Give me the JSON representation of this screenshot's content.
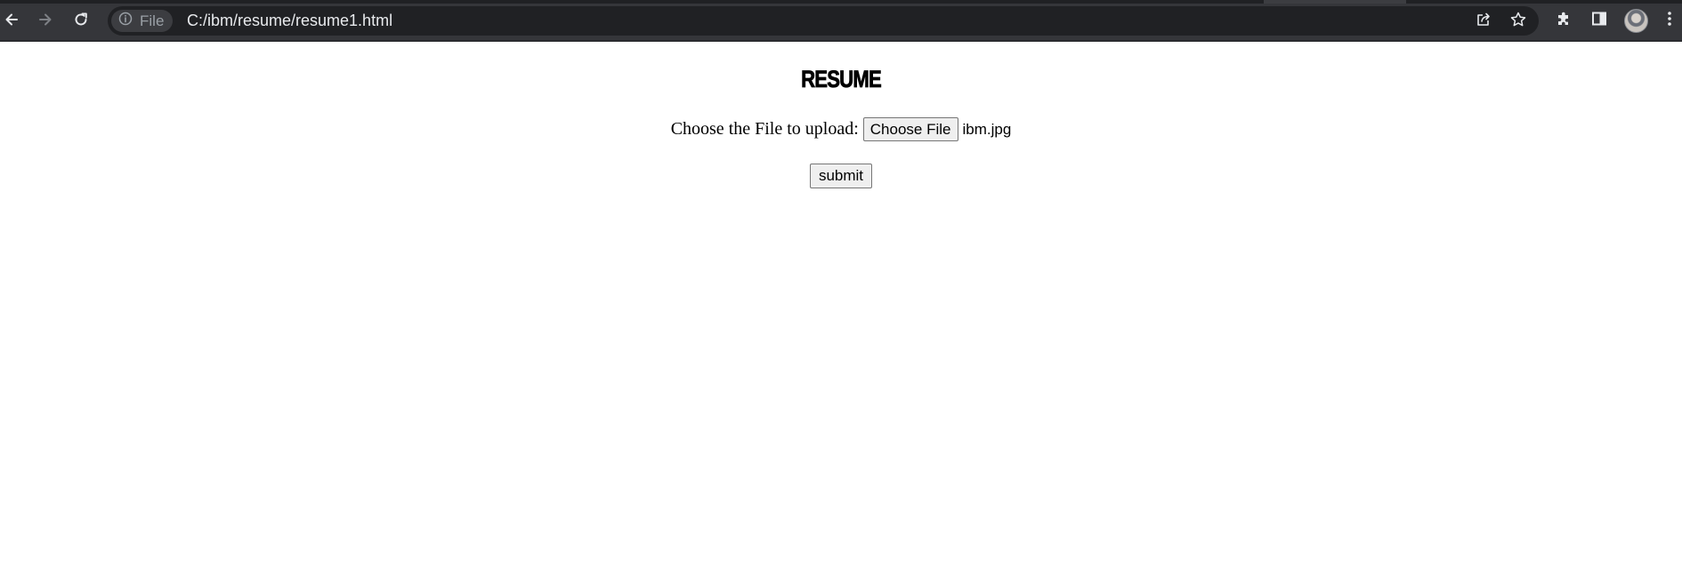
{
  "browser": {
    "site_chip_label": "File",
    "url": "C:/ibm/resume/resume1.html",
    "icons": {
      "back": "arrow-left-icon",
      "forward": "arrow-right-icon",
      "reload": "reload-icon",
      "site_info": "info-icon",
      "share": "share-icon",
      "bookmark": "star-icon",
      "extensions": "puzzle-icon",
      "side_panel": "side-panel-icon",
      "menu": "kebab-menu-icon"
    },
    "colors": {
      "toolbar_bg": "#35363a",
      "omnibox_bg": "#202124",
      "url_text": "#e8eaed"
    }
  },
  "page": {
    "heading": "RESUME",
    "upload_label": "Choose the File to upload:",
    "file_button_label": "Choose File",
    "selected_file": "ibm.jpg",
    "submit_label": "submit"
  }
}
